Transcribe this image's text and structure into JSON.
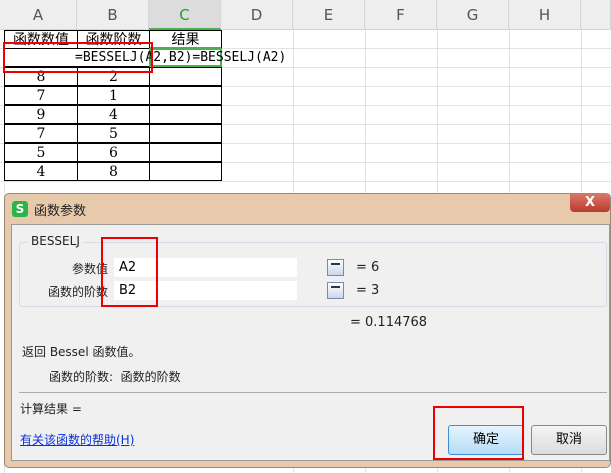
{
  "columns": [
    "A",
    "B",
    "C",
    "D",
    "E",
    "F",
    "G",
    "H"
  ],
  "headers": [
    "函数数值",
    "函数阶数",
    "结果"
  ],
  "formula_cell": "=BESSELJ(A2,B2)=BESSELJ(A2)",
  "rows": [
    [
      "8",
      "2"
    ],
    [
      "7",
      "1"
    ],
    [
      "9",
      "4"
    ],
    [
      "7",
      "5"
    ],
    [
      "5",
      "6"
    ],
    [
      "4",
      "8"
    ]
  ],
  "dialog": {
    "title": "函数参数",
    "close": "X",
    "function_name": "BESSELJ",
    "args": [
      {
        "label": "参数值",
        "value": "A2",
        "result": "= 6"
      },
      {
        "label": "函数的阶数",
        "value": "B2",
        "result": "= 3"
      }
    ],
    "formula_result": "= 0.114768",
    "description": "返回 Bessel 函数值。",
    "arg_help": "函数的阶数:  函数的阶数",
    "calc_result": "计算结果 =",
    "help_link": "有关该函数的帮助(H)",
    "ok": "确定",
    "cancel": "取消"
  }
}
